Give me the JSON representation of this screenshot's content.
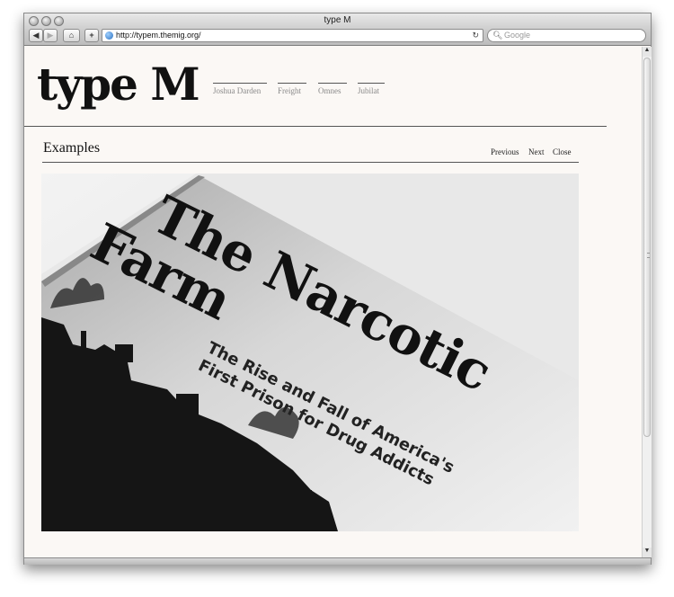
{
  "browser": {
    "title": "type M",
    "url": "http://typem.themig.org/",
    "search_placeholder": "Google",
    "back_label": "◀",
    "forward_label": "▶",
    "home_label": "⌂",
    "add_label": "+",
    "reload_label": "↻",
    "search_icon": "search-icon"
  },
  "site": {
    "logo": "type M",
    "nav": [
      {
        "label": "Joshua Darden"
      },
      {
        "label": "Freight"
      },
      {
        "label": "Omnes"
      },
      {
        "label": "Jubilat"
      }
    ],
    "section_title": "Examples",
    "pager": {
      "previous": "Previous",
      "next": "Next",
      "close": "Close"
    }
  },
  "photo": {
    "headline_line1": "The Narcotic",
    "headline_line2": "Farm",
    "subtitle_line1": "The Rise and Fall of America's",
    "subtitle_line2": "First Prison for Drug Addicts"
  },
  "colors": {
    "page_bg": "#fbf8f5",
    "rule": "#555555",
    "nav_text": "#8a8a8a"
  }
}
